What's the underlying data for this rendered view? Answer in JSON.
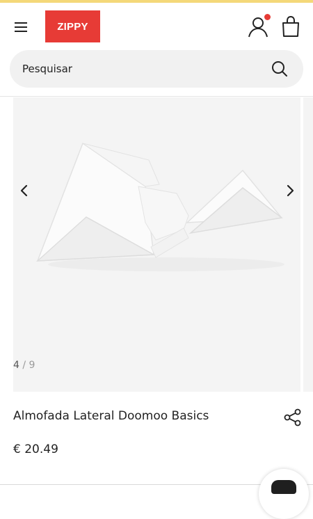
{
  "header": {
    "logo_text": "ZIPPY",
    "brand_color": "#e73b36",
    "icons": [
      "hamburger-menu-icon",
      "user-account-icon",
      "shopping-bag-icon"
    ]
  },
  "search": {
    "placeholder": "Pesquisar",
    "icon": "search-icon"
  },
  "gallery": {
    "current": "4",
    "separator": "/",
    "total": "9",
    "icons": [
      "chevron-left-icon",
      "chevron-right-icon"
    ]
  },
  "product": {
    "title": "Almofada Lateral Doomoo Basics",
    "price": "€ 20.49",
    "share_icon": "share-icon"
  },
  "colors": {
    "top_strip": "#f4d879",
    "notification_dot": "#e63b36",
    "search_bg": "#f1f1f1",
    "gallery_bg": "#f4f4f4"
  }
}
